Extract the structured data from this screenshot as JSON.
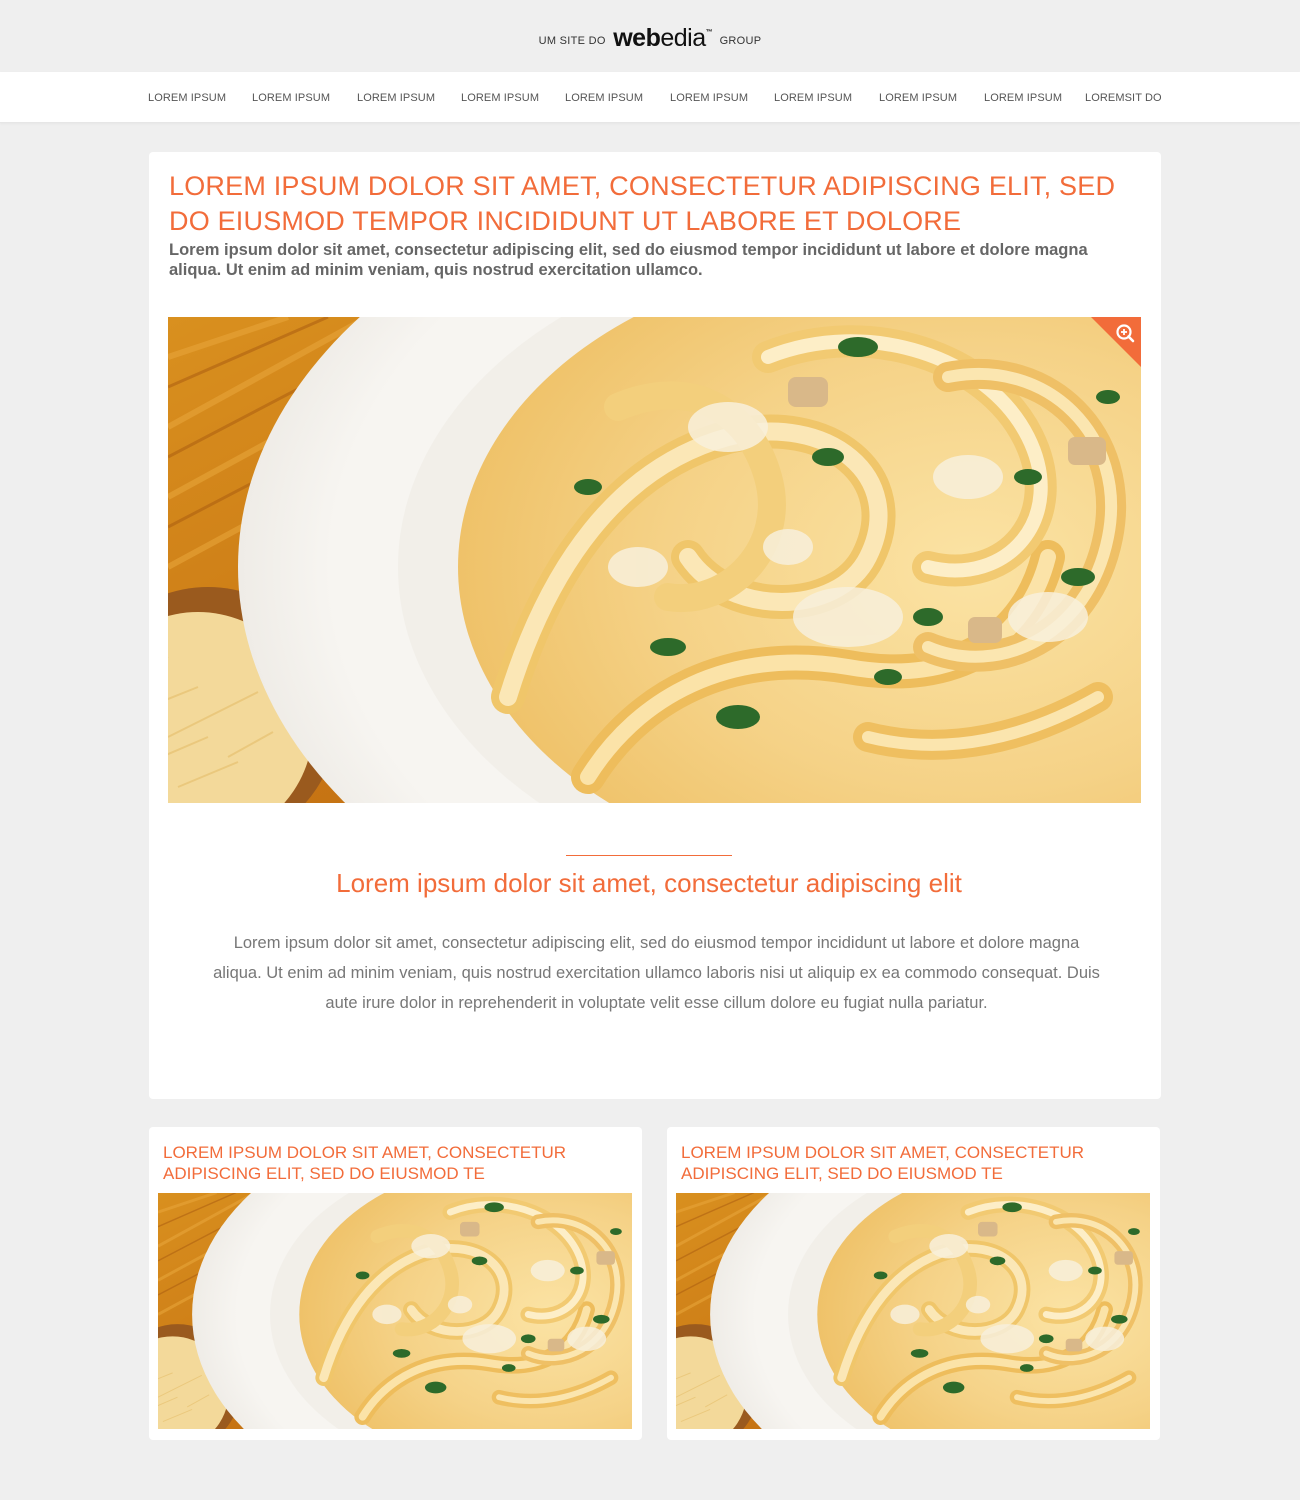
{
  "brand": {
    "prefix": "UM SITE DO",
    "logo_bold": "web",
    "logo_light": "edia",
    "trademark": "™",
    "suffix": "GROUP"
  },
  "nav": {
    "items": [
      {
        "label": "LOREM IPSUM"
      },
      {
        "label": "LOREM IPSUM"
      },
      {
        "label": "LOREM IPSUM"
      },
      {
        "label": "LOREM IPSUM"
      },
      {
        "label": "LOREM IPSUM"
      },
      {
        "label": "LOREM IPSUM"
      },
      {
        "label": "LOREM IPSUM"
      },
      {
        "label": "LOREM IPSUM"
      },
      {
        "label": "LOREM IPSUM"
      },
      {
        "label": "LOREMSIT DO"
      }
    ]
  },
  "article": {
    "headline": "LOREM IPSUM DOLOR SIT AMET, CONSECTETUR ADIPISCING ELIT, SED DO EIUSMOD TEMPOR INCIDIDUNT UT LABORE ET DOLORE",
    "lead": "Lorem ipsum dolor sit amet, consectetur adipiscing elit, sed do eiusmod tempor incididunt ut labore et dolore magna aliqua. Ut enim ad minim veniam, quis nostrud exercitation ullamco.",
    "hero_icon": "zoom-in-icon",
    "subhead": "Lorem ipsum dolor sit amet, consectetur adipiscing elit",
    "body": "Lorem ipsum dolor sit amet, consectetur adipiscing elit, sed do eiusmod tempor incididunt ut labore et dolore magna aliqua. Ut enim ad minim veniam, quis nostrud exercitation ullamco laboris nisi ut aliquip ex ea commodo consequat. Duis aute irure dolor in reprehenderit in voluptate velit esse cillum dolore eu fugiat nulla pariatur."
  },
  "related": [
    {
      "title": "LOREM IPSUM DOLOR SIT AMET, CONSECTETUR ADIPISCING ELIT, SED DO EIUSMOD TE"
    },
    {
      "title": "LOREM IPSUM DOLOR SIT AMET, CONSECTETUR ADIPISCING ELIT, SED DO EIUSMOD TE"
    }
  ],
  "colors": {
    "accent": "#f26c3a",
    "background": "#efefef",
    "card": "#ffffff",
    "text": "#666666"
  }
}
